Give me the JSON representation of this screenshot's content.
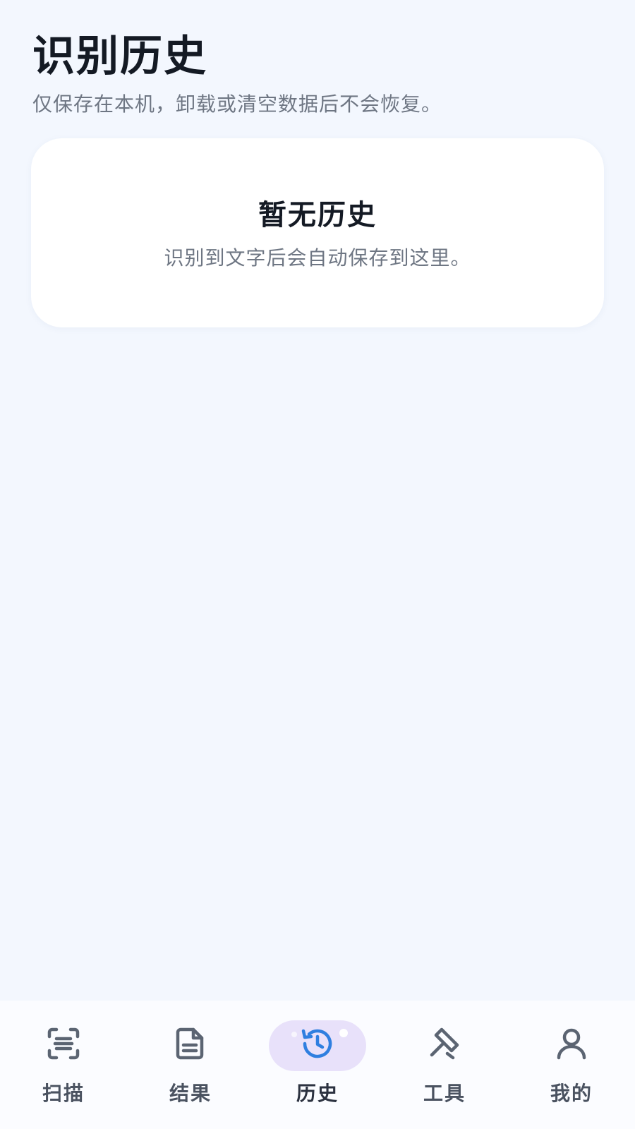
{
  "header": {
    "title": "识别历史",
    "subtitle": "仅保存在本机，卸载或清空数据后不会恢复。"
  },
  "empty_state": {
    "title": "暂无历史",
    "description": "识别到文字后会自动保存到这里。"
  },
  "tabbar": {
    "active": "history",
    "tabs": [
      {
        "id": "scan",
        "label": "扫描",
        "icon": "scan-icon"
      },
      {
        "id": "result",
        "label": "结果",
        "icon": "document-icon"
      },
      {
        "id": "history",
        "label": "历史",
        "icon": "history-clock-icon"
      },
      {
        "id": "tools",
        "label": "工具",
        "icon": "tools-icon"
      },
      {
        "id": "mine",
        "label": "我的",
        "icon": "user-icon"
      }
    ]
  },
  "colors": {
    "background": "#f3f7fe",
    "card": "#ffffff",
    "title_text": "#141a24",
    "secondary_text": "#6e7683",
    "tab_icon": "#5b6472",
    "active_pill": "#e8e1fa",
    "active_icon": "#2f7fe0"
  }
}
